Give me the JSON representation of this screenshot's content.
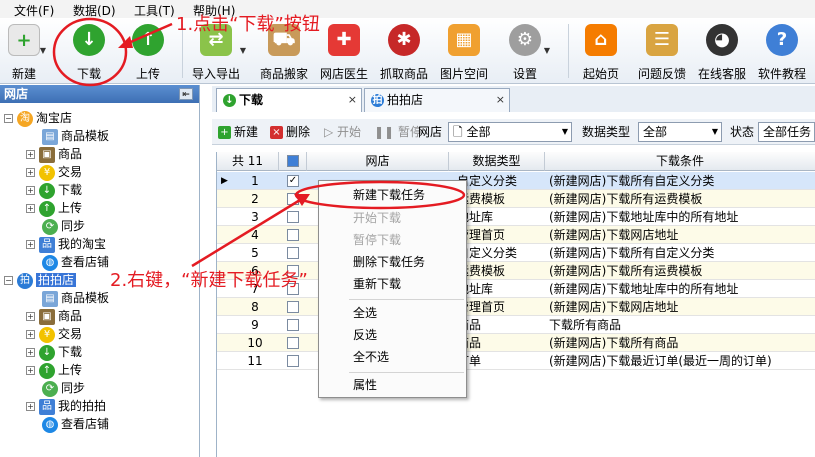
{
  "menu": [
    "文件(F)",
    "数据(D)",
    "工具(T)",
    "帮助(H)"
  ],
  "toolbar": {
    "new": "新建",
    "download": "下载",
    "upload": "上传",
    "import_export": "导入导出",
    "move": "商品搬家",
    "doctor": "网店医生",
    "grab": "抓取商品",
    "pic": "图片空间",
    "settings": "设置",
    "home": "起始页",
    "feedback": "问题反馈",
    "service": "在线客服",
    "tutorial": "软件教程"
  },
  "sidebar": {
    "title": "网店",
    "pin": "⇤",
    "stores": [
      {
        "name": "淘宝店",
        "icon_char": "淘",
        "items": [
          "商品模板",
          "商品",
          "交易",
          "下载",
          "上传",
          "同步",
          "我的淘宝",
          "查看店铺"
        ]
      },
      {
        "name": "拍拍店",
        "icon_char": "拍",
        "items": [
          "商品模板",
          "商品",
          "交易",
          "下载",
          "上传",
          "同步",
          "我的拍拍",
          "查看店铺"
        ]
      }
    ]
  },
  "tabs": [
    {
      "label": "下载",
      "close": "×"
    },
    {
      "label": "拍拍店",
      "close": "×"
    }
  ],
  "subbar": {
    "new": "新建",
    "delete": "删除",
    "start": "开始",
    "pause": "暂停",
    "store_label": "网店",
    "store_value": "全部",
    "type_label": "数据类型",
    "type_value": "全部",
    "status_label": "状态",
    "status_value": "全部任务"
  },
  "grid": {
    "count": "共 11",
    "headers": [
      "网店",
      "数据类型",
      "下载条件"
    ],
    "rows": [
      {
        "n": "1",
        "type": "自定义分类",
        "cond": "(新建网店)下载所有自定义分类"
      },
      {
        "n": "2",
        "type": "运费模板",
        "cond": "(新建网店)下载所有运费模板"
      },
      {
        "n": "3",
        "type": "地址库",
        "cond": "(新建网店)下载地址库中的所有地址"
      },
      {
        "n": "4",
        "type": "管理首页",
        "cond": "(新建网店)下载网店地址"
      },
      {
        "n": "5",
        "type": "自定义分类",
        "cond": "(新建网店)下载所有自定义分类"
      },
      {
        "n": "6",
        "type": "运费模板",
        "cond": "(新建网店)下载所有运费模板"
      },
      {
        "n": "7",
        "type": "地址库",
        "cond": "(新建网店)下载地址库中的所有地址"
      },
      {
        "n": "8",
        "type": "管理首页",
        "cond": "(新建网店)下载网店地址"
      },
      {
        "n": "9",
        "type": "商品",
        "cond": "下载所有商品"
      },
      {
        "n": "10",
        "type": "商品",
        "cond": "(新建网店)下载所有商品"
      },
      {
        "n": "11",
        "type": "订单",
        "cond": "(新建网店)下载最近订单(最近一周的订单)"
      }
    ]
  },
  "context_menu": [
    "新建下载任务",
    "开始下载",
    "暂停下载",
    "删除下载任务",
    "重新下载",
    "全选",
    "反选",
    "全不选",
    "属性"
  ],
  "annotations": {
    "step1": "1.点击“下载”按钮",
    "step2": "2.右键，“新建下载任务”"
  },
  "colors": {
    "accent": "#e41b22",
    "selection": "#3875d7",
    "green": "#2fa32f"
  }
}
